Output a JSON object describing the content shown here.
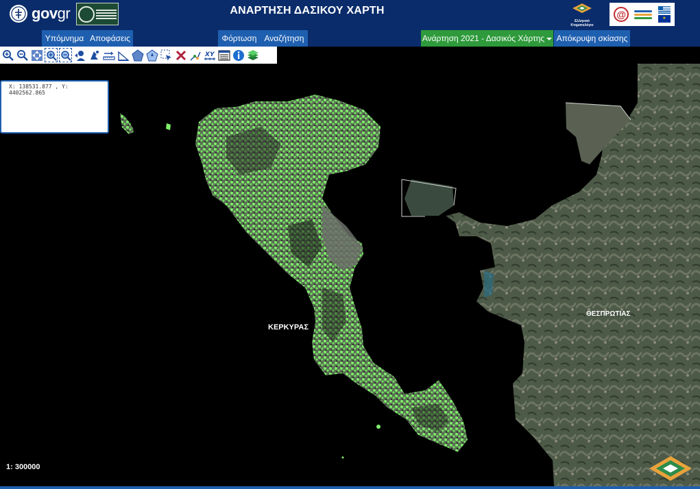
{
  "header": {
    "gov_logo_main": "gov",
    "gov_logo_suffix": "gr",
    "title": "ΑΝΑΡΤΗΣΗ ΔΑΣΙΚΟΥ ΧΑΡΤΗ",
    "ktimatologio_label": "Ελληνικό Κτηματολόγιο"
  },
  "nav": {
    "legend": "Υπόμνημα",
    "decisions": "Αποφάσεις",
    "load": "Φόρτωση",
    "search": "Αναζήτηση",
    "layer_select": "Ανάρτηση 2021 - Δασικός Χάρτης",
    "hide_shading": "Απόκρυψη σκίασης"
  },
  "toolbar": {
    "tools": [
      "zoom-in-icon",
      "zoom-out-icon",
      "pan-icon",
      "zoom-box-in-icon",
      "zoom-box-out-icon",
      "user-pin-icon",
      "identify-icon",
      "measure-line-icon",
      "measure-area-icon",
      "polygon-icon",
      "star-shape-icon",
      "select-arrow-icon",
      "clear-icon",
      "draw-point-icon",
      "xy-icon",
      "layers-table-icon",
      "info-icon",
      "layers-icon"
    ],
    "xy_text": "XY"
  },
  "coords": {
    "text": "X: 138531.877 , Y: 4402562.865"
  },
  "map": {
    "label_corfu": "ΚΕΡΚΥΡΑΣ",
    "label_thesprotia": "ΘΕΣΠΡΩΤΙΑΣ",
    "scale": "1: 300000",
    "forest_color": "#7ff06a",
    "land_color": "#4a5646",
    "sea_color": "#000000"
  }
}
